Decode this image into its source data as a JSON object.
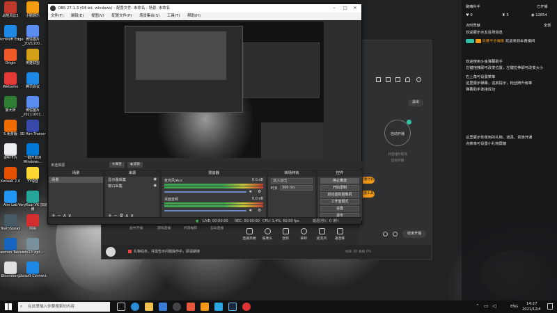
{
  "colors": {
    "accent": "#f29a17",
    "accent_dark": "#f08a00",
    "obs_bg": "#2e2e2e",
    "taskbar": "#101113"
  },
  "side_panel": {
    "username": "路痛衫手",
    "online_label": "已开播",
    "stat_likes": "0",
    "stat_fans": "5",
    "stat_views": "12854",
    "col_left": "点时贡献",
    "col_right": "全部",
    "chat": [
      {
        "text": "欢迎展示水友进场消息",
        "color": "#e8e8e8"
      },
      {
        "badge": "new",
        "name": "风萧不会唱歌",
        "text": "欢迎来到本直播间",
        "color": "#f29a17"
      },
      {
        "text": "欢迎使用斗鱼弹幕助手",
        "color": "#e8e8e8"
      },
      {
        "text": "左键拖拽即可改变位置，左键拉伸即可改变大小",
        "color": "#e8e8e8"
      },
      {
        "text": "右上角可设置菜单",
        "color": "#e8e8e8"
      },
      {
        "text": "这里展示弹幕，进房提示，粉丝牌升级等",
        "color": "#e8e8e8"
      },
      {
        "text": "弹幕助手连接成功",
        "color": "#e8e8e8"
      },
      {
        "text": "这里展示你收到的礼物、道具、贵族开通",
        "color": "#e8e8e8"
      },
      {
        "text": "点菜单可设置小礼物屏蔽",
        "color": "#e8e8e8"
      }
    ]
  },
  "assistant": {
    "stop_label": "退出",
    "start_label": "自动开播",
    "hint_top": "开启随时取消",
    "hint_bottom": "自动开播",
    "tab_labels": [
      "画中开播",
      "游戏直播",
      "好游推荐",
      "互动直播"
    ],
    "tools": [
      "直播高端",
      "摄像头",
      "音频",
      "录制",
      "麦克风",
      "语音聊"
    ],
    "right_btn": "结束开播",
    "notice": "礼物任务、共需告示问题操作中，即请期待",
    "fps_text": "帧率 30   丢帧 0%",
    "pills": [
      "开播计划",
      "直播工具"
    ]
  },
  "obs": {
    "title": "OBS 27.1.3 (64-bit, windows) - 配置文件: 未命名 - 场景: 未命名",
    "menu": [
      "文件(F)",
      "编辑(E)",
      "视图(V)",
      "配置文件(P)",
      "场景集合(S)",
      "工具(T)",
      "帮助(H)"
    ],
    "source_label": "未选择源",
    "prop_btn": "属性",
    "filter_btn": "滤镜",
    "docks": {
      "scenes": {
        "title": "场景",
        "items": [
          "场景"
        ]
      },
      "sources": {
        "title": "来源",
        "items": [
          "显示器采集",
          "窗口采集"
        ]
      },
      "mixer": {
        "title": "混音器",
        "channels": [
          {
            "name": "麦克风/Aux",
            "db": "0.0 dB"
          },
          {
            "name": "桌面音频",
            "db": "0.0 dB"
          }
        ]
      },
      "transitions": {
        "title": "转场特效",
        "type": "淡入淡出",
        "duration_label": "时长",
        "duration": "300 ms"
      },
      "controls": {
        "title": "控件",
        "buttons": [
          "停止推流",
          "开始录制",
          "启动虚拟摄像机",
          "工作室模式",
          "设置",
          "退出"
        ]
      }
    },
    "status": {
      "live": "LIVE: 00:00:00",
      "rec": "REC: 00:00:00",
      "cpu": "CPU: 1.4%, 60.00 fps",
      "delay": "延迟(秒)：0 (秒)"
    }
  },
  "desktop_icons": [
    "战地风云5",
    "小鹅娱乐",
    "Microsoft Edge",
    "微信图片_2021100...",
    "Origin",
    "英雄联盟",
    "WeGame",
    "腾讯会议",
    "鲁大师",
    "微信图片_20211001...",
    "5.免费版",
    "3D Aim Trainer",
    "说明卡片",
    "一键开启对 Windows...",
    "KovaaK 2.0",
    "YY语音",
    "Aim Lab",
    "VeryKuai VK 加速器",
    "TeamSpeak",
    "网易",
    "Gaomon Tablet",
    "win10_opt...",
    "Bloomberg",
    "Ubisoft Connect"
  ],
  "taskbar": {
    "search_placeholder": "在这里输入你要搜索的内容",
    "time": "14:27",
    "date": "2021/12/4",
    "lang": "ENG"
  }
}
